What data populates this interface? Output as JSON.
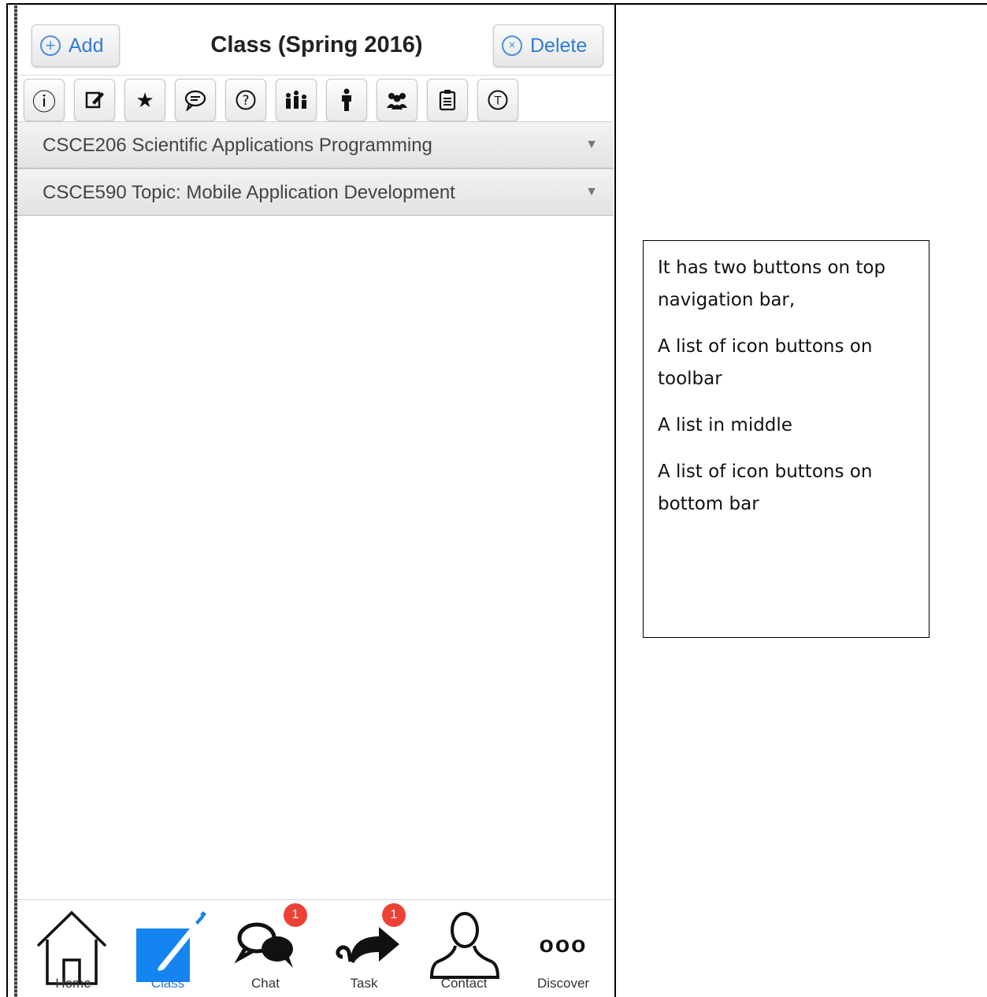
{
  "header": {
    "title": "Class (Spring 2016)",
    "add_label": "Add",
    "delete_label": "Delete",
    "add_icon": "plus-circle-icon",
    "delete_icon": "x-circle-icon",
    "accent_color": "#2e7bd6"
  },
  "toolbar": {
    "buttons": [
      {
        "icon": "info-icon",
        "glyph": "ⓘ"
      },
      {
        "icon": "edit-icon",
        "glyph": "✎"
      },
      {
        "icon": "star-icon",
        "glyph": "★"
      },
      {
        "icon": "comment-icon",
        "glyph": "💬"
      },
      {
        "icon": "help-icon",
        "glyph": "?"
      },
      {
        "icon": "chart-icon",
        "glyph": "ılı"
      },
      {
        "icon": "person-icon",
        "glyph": "🚹"
      },
      {
        "icon": "group-icon",
        "glyph": "👥"
      },
      {
        "icon": "clipboard-icon",
        "glyph": "📋"
      },
      {
        "icon": "t-circle-icon",
        "glyph": "T"
      }
    ]
  },
  "list": {
    "items": [
      {
        "label": "CSCE206 Scientific Applications Programming"
      },
      {
        "label": "CSCE590 Topic: Mobile Application Development"
      }
    ]
  },
  "bottom_tabs": [
    {
      "label": "Home",
      "icon": "home-icon"
    },
    {
      "label": "Class",
      "icon": "class-edit-icon",
      "active": true
    },
    {
      "label": "Chat",
      "icon": "chat-icon",
      "badge": "1"
    },
    {
      "label": "Task",
      "icon": "share-icon",
      "badge": "1"
    },
    {
      "label": "Contact",
      "icon": "contact-icon"
    },
    {
      "label": "Discover",
      "icon": "more-icon",
      "glyph": "ooo"
    }
  ],
  "note": {
    "lines": [
      "It has two buttons on top navigation bar,",
      "A list of icon buttons on toolbar",
      "A list in middle",
      "A list of icon buttons on bottom bar"
    ]
  }
}
